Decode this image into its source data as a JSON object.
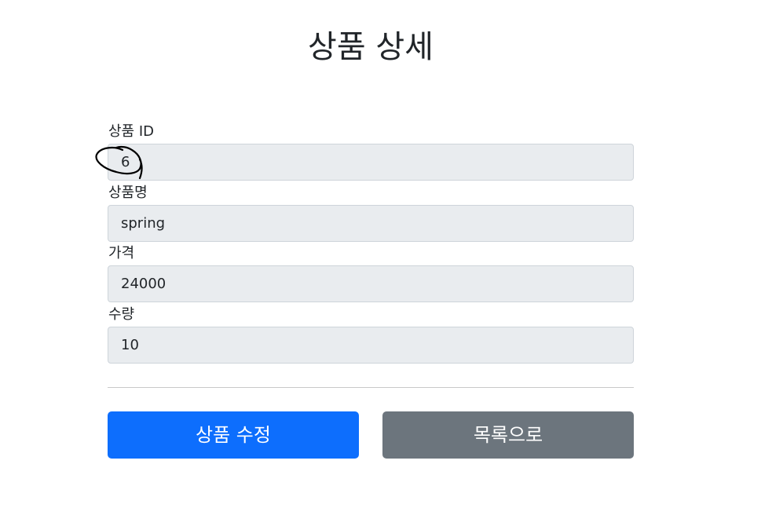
{
  "page": {
    "title": "상품 상세"
  },
  "form": {
    "fields": [
      {
        "label": "상품 ID",
        "value": "6"
      },
      {
        "label": "상품명",
        "value": "spring"
      },
      {
        "label": "가격",
        "value": "24000"
      },
      {
        "label": "수량",
        "value": "10"
      }
    ]
  },
  "actions": {
    "edit_label": "상품 수정",
    "list_label": "목록으로"
  },
  "colors": {
    "primary": "#0d6efd",
    "secondary": "#6c757d",
    "input_bg": "#e9ecef"
  }
}
